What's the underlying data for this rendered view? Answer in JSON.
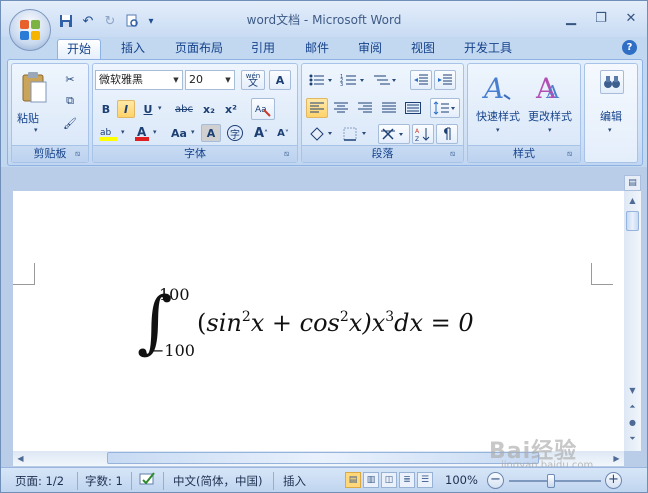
{
  "window": {
    "title": "word文档 - Microsoft Word"
  },
  "qat": {
    "save": "save-icon",
    "undo": "undo-icon",
    "redo": "redo-icon",
    "preview": "print-preview-icon",
    "customize": "▾"
  },
  "tabs": [
    {
      "label": "开始",
      "active": true
    },
    {
      "label": "插入"
    },
    {
      "label": "页面布局"
    },
    {
      "label": "引用"
    },
    {
      "label": "邮件"
    },
    {
      "label": "审阅"
    },
    {
      "label": "视图"
    },
    {
      "label": "开发工具"
    }
  ],
  "ribbon": {
    "clipboard": {
      "label": "剪贴板",
      "paste": "粘贴"
    },
    "font": {
      "label": "字体",
      "font_name": "微软雅黑",
      "font_size": "20",
      "bold": "B",
      "italic": "I",
      "underline": "U",
      "strike": "abc",
      "sub": "x₂",
      "sup": "x²",
      "case": "Aa",
      "grow": "A",
      "shrink": "A",
      "phonetic": "wén",
      "phonetic_char": "文",
      "enclose": "字",
      "border_char": "A"
    },
    "paragraph": {
      "label": "段落"
    },
    "styles": {
      "label": "样式",
      "quick": "快速样式",
      "change": "更改样式"
    },
    "editing": {
      "label": "编辑"
    }
  },
  "equation": {
    "upper": "100",
    "lower": "−100",
    "lparen": "(",
    "sin": "sin",
    "sin_exp": "2",
    "x1": "x + ",
    "cos": "cos",
    "cos_exp": "2",
    "x2": "x)x",
    "x_exp": "3",
    "tail": "dx = 0"
  },
  "status": {
    "page": "页面: 1/2",
    "words": "字数: 1",
    "lang": "中文(简体，中国)",
    "mode": "插入",
    "zoom": "100%"
  },
  "watermark": {
    "text": "Bai经验",
    "sub": "jingyan.baidu.com"
  }
}
